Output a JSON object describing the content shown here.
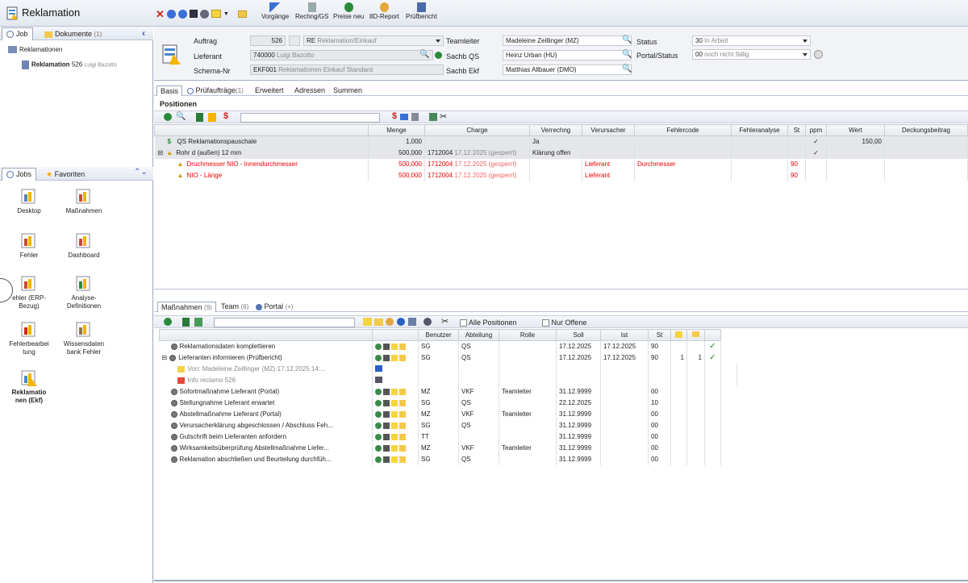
{
  "app": {
    "title": "Reklamation"
  },
  "toolbar": {
    "vorgaenge": "Vorgänge",
    "rechng": "Rechng/GS",
    "preise": "Preise neu",
    "report": "8D-Report",
    "pruefbericht": "Prüfbericht"
  },
  "left": {
    "tab_job": "Job",
    "tab_dokumente": "Dokumente",
    "dokumente_count": "(1)",
    "tree_root": "Reklamationen",
    "tree_item": "Reklamation",
    "tree_item_no": "526",
    "tree_item_user": "Luigi Bazotto",
    "tab_jobs": "Jobs",
    "tab_favoriten": "Favoriten",
    "jobs": [
      {
        "label": "Desktop"
      },
      {
        "label": "Maßnahmen"
      },
      {
        "label": "Fehler"
      },
      {
        "label": "Dashboard"
      },
      {
        "label": "ehler (ERP-\nBezug)"
      },
      {
        "label": "Analyse-\nDefinitionen"
      },
      {
        "label": "Fehlerbearbei\ntung"
      },
      {
        "label": "Wissensdaten\nbank Fehler"
      },
      {
        "label": "Reklamatio\nnen (Ekf)"
      }
    ]
  },
  "header": {
    "auftrag_label": "Auftrag",
    "auftrag_value": "526",
    "auftrag_type": "RE",
    "auftrag_type_desc": "Reklamation/Einkauf",
    "lieferant_label": "Lieferant",
    "lieferant_no": "740000",
    "lieferant_name": "Luigi Bazotto",
    "schema_label": "Schema-Nr",
    "schema_no": "EKF001",
    "schema_desc": "Reklamationen Einkauf Standard",
    "teamleiter_label": "Teamleiter",
    "teamleiter_value": "Madeleine Zeillinger (MZ)",
    "sachbqs_label": "Sachb QS",
    "sachbqs_value": "Heinz Urban (HU)",
    "sachbekf_label": "Sachb Ekf",
    "sachbekf_value": "Matthias Allbauer (DMO)",
    "status_label": "Status",
    "status_no": "30",
    "status_desc": "In Arbeit",
    "portal_label": "Portal/Status",
    "portal_no": "00",
    "portal_desc": "noch nicht fällig"
  },
  "tabs": [
    {
      "label": "Basis"
    },
    {
      "label": "Prüfaufträge",
      "count": "(1)"
    },
    {
      "label": "Erweitert"
    },
    {
      "label": "Adressen"
    },
    {
      "label": "Summen"
    }
  ],
  "positionen": {
    "title": "Positionen",
    "columns": [
      "Menge",
      "Charge",
      "Verrechng",
      "Verursacher",
      "Fehlercode",
      "Fehleranalyse",
      "St",
      "ppm",
      "Wert",
      "Deckungsbeitrag"
    ],
    "rows": [
      {
        "name": "QS Reklamationspauschale",
        "menge": "1,000",
        "charge": "",
        "charge_date": "",
        "verrechng": "Ja",
        "verursacher": "",
        "fehlercode": "",
        "st": "",
        "ppm": "✓",
        "wert": "150,00"
      },
      {
        "name": "Rohr d (außen) 12 mm",
        "menge": "500,000",
        "charge": "1712004",
        "charge_date": "17.12.2025 (gesperrt)",
        "verrechng": "Klärung offen",
        "verursacher": "",
        "fehlercode": "",
        "st": "",
        "ppm": "✓",
        "wert": ""
      },
      {
        "name": "Druchmesser NIO  - Innendurchmesser",
        "menge": "500,000",
        "charge": "1712004",
        "charge_date": "17.12.2025 (gesperrt)",
        "verrechng": "",
        "verursacher": "Lieferant",
        "fehlercode": "Durchmesser",
        "st": "90",
        "ppm": "",
        "wert": ""
      },
      {
        "name": "NIO - Länge",
        "menge": "500,000",
        "charge": "1712004",
        "charge_date": "17.12.2025 (gesperrt)",
        "verrechng": "",
        "verursacher": "Lieferant",
        "fehlercode": "",
        "st": "90",
        "ppm": "",
        "wert": ""
      }
    ]
  },
  "tabs_lower": [
    {
      "label": "Maßnahmen",
      "count": "(9)"
    },
    {
      "label": "Team",
      "count": "(6)"
    },
    {
      "label": "Portal",
      "count": "(+)"
    }
  ],
  "massnahmen": {
    "alle_positionen": "Alle Positionen",
    "nur_offene": "Nur Offene",
    "columns": [
      "Benutzer",
      "Abteilung",
      "Rolle",
      "Soll",
      "Ist",
      "St"
    ],
    "rows": [
      {
        "name": "Reklamationsdaten komplettieren",
        "benutzer": "SG",
        "abteilung": "QS",
        "rolle": "",
        "soll": "17.12.2025",
        "ist": "17.12.2025",
        "st": "90",
        "a": "",
        "b": "",
        "done": "✓"
      },
      {
        "name": "Lieferanten informieren (Prüfbericht)",
        "benutzer": "SG",
        "abteilung": "QS",
        "rolle": "",
        "soll": "17.12.2025",
        "ist": "17.12.2025",
        "st": "90",
        "a": "1",
        "b": "1",
        "done": "✓"
      },
      {
        "name": "Von: Madeleine Zeillinger (MZ) 17.12.2025 14:...",
        "sub": true
      },
      {
        "name": "Info reclamo 526",
        "sub": true
      },
      {
        "name": "Sofortmaßnahme Lieferant (Portal)",
        "benutzer": "MZ",
        "abteilung": "VKF",
        "rolle": "Teamleiter",
        "soll": "31.12.9999",
        "ist": "",
        "st": "00",
        "a": "",
        "b": "",
        "done": ""
      },
      {
        "name": "Stellungnahme Lieferant erwartet",
        "benutzer": "SG",
        "abteilung": "QS",
        "rolle": "",
        "soll": "22.12.2025",
        "ist": "",
        "st": "10",
        "a": "",
        "b": "",
        "done": ""
      },
      {
        "name": "Abstellmaßnahme Lieferant (Portal)",
        "benutzer": "MZ",
        "abteilung": "VKF",
        "rolle": "Teamleiter",
        "soll": "31.12.9999",
        "ist": "",
        "st": "00",
        "a": "",
        "b": "",
        "done": ""
      },
      {
        "name": "Verursacherklärung abgeschlossen / Abschluss Feh...",
        "benutzer": "SG",
        "abteilung": "QS",
        "rolle": "",
        "soll": "31.12.9999",
        "ist": "",
        "st": "00",
        "a": "",
        "b": "",
        "done": ""
      },
      {
        "name": "Gutschrift beim Lieferanten anfordern",
        "benutzer": "TT",
        "abteilung": "",
        "rolle": "",
        "soll": "31.12.9999",
        "ist": "",
        "st": "00",
        "a": "",
        "b": "",
        "done": ""
      },
      {
        "name": "Wirksamkeitsüberprüfung Abstellmaßnahme Liefer...",
        "benutzer": "MZ",
        "abteilung": "VKF",
        "rolle": "Teamleiter",
        "soll": "31.12.9999",
        "ist": "",
        "st": "00",
        "a": "",
        "b": "",
        "done": ""
      },
      {
        "name": "Reklamation abschließen und Beurteilung durchfüh...",
        "benutzer": "SG",
        "abteilung": "QS",
        "rolle": "",
        "soll": "31.12.9999",
        "ist": "",
        "st": "00",
        "a": "",
        "b": "",
        "done": ""
      }
    ]
  }
}
